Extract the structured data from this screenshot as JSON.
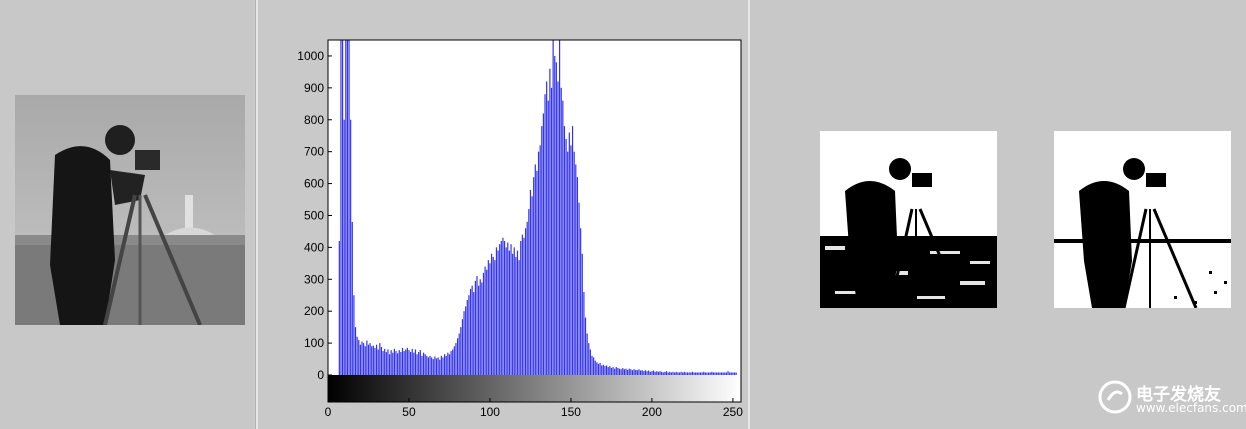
{
  "watermark": {
    "text_cn": "电子发烧友",
    "url": "www.elecfans.com"
  },
  "images": {
    "original": "cameraman-grayscale-photo",
    "binary_1": "cameraman-binary-threshold-1",
    "binary_2": "cameraman-binary-threshold-2"
  },
  "colors": {
    "bars": "#3333ee",
    "background": "#c8c8c8",
    "plot_bg": "#ffffff"
  },
  "chart_data": {
    "type": "bar",
    "title": "",
    "xlabel": "",
    "ylabel": "",
    "xlim": [
      0,
      255
    ],
    "ylim": [
      0,
      1050
    ],
    "x_ticks": [
      0,
      50,
      100,
      150,
      200,
      250
    ],
    "y_ticks": [
      0,
      100,
      200,
      300,
      400,
      500,
      600,
      700,
      800,
      900,
      1000
    ],
    "colorbar": "grayscale gradient 0-255 below x-axis",
    "bins_x": [
      7,
      8,
      9,
      10,
      11,
      12,
      13,
      14,
      15,
      16,
      17,
      18,
      19,
      20,
      21,
      22,
      23,
      24,
      25,
      26,
      27,
      28,
      29,
      30,
      31,
      32,
      33,
      34,
      35,
      36,
      37,
      38,
      39,
      40,
      41,
      42,
      43,
      44,
      45,
      46,
      47,
      48,
      49,
      50,
      51,
      52,
      53,
      54,
      55,
      56,
      57,
      58,
      59,
      60,
      61,
      62,
      63,
      64,
      65,
      66,
      67,
      68,
      69,
      70,
      71,
      72,
      73,
      74,
      75,
      76,
      77,
      78,
      79,
      80,
      81,
      82,
      83,
      84,
      85,
      86,
      87,
      88,
      89,
      90,
      91,
      92,
      93,
      94,
      95,
      96,
      97,
      98,
      99,
      100,
      101,
      102,
      103,
      104,
      105,
      106,
      107,
      108,
      109,
      110,
      111,
      112,
      113,
      114,
      115,
      116,
      117,
      118,
      119,
      120,
      121,
      122,
      123,
      124,
      125,
      126,
      127,
      128,
      129,
      130,
      131,
      132,
      133,
      134,
      135,
      136,
      137,
      138,
      139,
      140,
      141,
      142,
      143,
      144,
      145,
      146,
      147,
      148,
      149,
      150,
      151,
      152,
      153,
      154,
      155,
      156,
      157,
      158,
      159,
      160,
      161,
      162,
      163,
      164,
      165,
      166,
      167,
      168,
      169,
      170,
      171,
      172,
      173,
      174,
      175,
      176,
      177,
      178,
      179,
      180,
      181,
      182,
      183,
      184,
      185,
      186,
      187,
      188,
      189,
      190,
      191,
      192,
      193,
      194,
      195,
      196,
      197,
      198,
      199,
      200,
      201,
      202,
      203,
      204,
      205,
      206,
      207,
      208,
      209,
      210,
      211,
      212,
      213,
      214,
      215,
      216,
      217,
      218,
      219,
      220,
      221,
      222,
      223,
      224,
      225,
      226,
      227,
      228,
      229,
      230,
      231,
      232,
      233,
      234,
      235,
      236,
      237,
      238,
      239,
      240,
      241,
      242,
      243,
      244,
      245,
      246,
      247,
      248,
      249,
      250,
      251,
      252
    ],
    "values": [
      420,
      1050,
      1050,
      800,
      1050,
      1050,
      1050,
      800,
      480,
      250,
      150,
      120,
      110,
      95,
      105,
      100,
      90,
      108,
      95,
      100,
      90,
      92,
      85,
      95,
      80,
      100,
      88,
      75,
      82,
      72,
      80,
      65,
      78,
      70,
      82,
      75,
      68,
      78,
      72,
      85,
      75,
      80,
      85,
      78,
      72,
      82,
      70,
      80,
      65,
      72,
      78,
      60,
      70,
      65,
      60,
      55,
      60,
      55,
      50,
      58,
      52,
      55,
      48,
      60,
      55,
      65,
      60,
      70,
      65,
      75,
      80,
      90,
      100,
      115,
      130,
      150,
      175,
      200,
      215,
      235,
      250,
      270,
      280,
      260,
      295,
      310,
      280,
      300,
      290,
      320,
      340,
      330,
      360,
      350,
      380,
      370,
      360,
      400,
      390,
      410,
      420,
      430,
      420,
      400,
      415,
      390,
      410,
      380,
      400,
      370,
      390,
      360,
      420,
      440,
      430,
      460,
      480,
      520,
      580,
      560,
      620,
      660,
      640,
      700,
      720,
      780,
      820,
      880,
      920,
      860,
      960,
      900,
      1050,
      1000,
      980,
      920,
      1050,
      900,
      860,
      780,
      740,
      700,
      760,
      720,
      780,
      700,
      660,
      620,
      540,
      460,
      380,
      260,
      180,
      130,
      100,
      80,
      60,
      55,
      45,
      40,
      35,
      38,
      30,
      32,
      28,
      30,
      25,
      28,
      22,
      25,
      20,
      25,
      22,
      20,
      18,
      22,
      18,
      20,
      16,
      20,
      18,
      15,
      18,
      16,
      15,
      18,
      14,
      15,
      12,
      15,
      12,
      14,
      10,
      12,
      14,
      10,
      12,
      10,
      12,
      10,
      8,
      10,
      12,
      8,
      10,
      8,
      10,
      8,
      10,
      8,
      8,
      10,
      8,
      10,
      8,
      8,
      8,
      8,
      10,
      8,
      8,
      8,
      8,
      8,
      8,
      10,
      8,
      8,
      8,
      8,
      10,
      8,
      8,
      8,
      8,
      8,
      8,
      8,
      8,
      8,
      12,
      8,
      8,
      8,
      8,
      8,
      8,
      8,
      8,
      8,
      8,
      8,
      8,
      8,
      8,
      8,
      8,
      10,
      8,
      25
    ]
  }
}
